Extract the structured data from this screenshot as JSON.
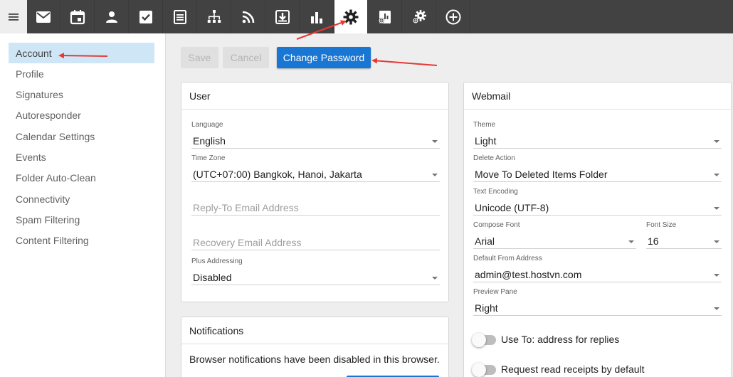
{
  "nav": {
    "icons": [
      "mail-icon",
      "calendar-icon",
      "contacts-icon",
      "tasks-icon",
      "notes-icon",
      "sitemap-icon",
      "rss-icon",
      "download-icon",
      "bar-chart-icon",
      "settings-icon",
      "domain-report-icon",
      "domain-settings-icon",
      "add-icon"
    ],
    "active": "settings-icon"
  },
  "sidebar": {
    "items": [
      {
        "label": "Account"
      },
      {
        "label": "Profile"
      },
      {
        "label": "Signatures"
      },
      {
        "label": "Autoresponder"
      },
      {
        "label": "Calendar Settings"
      },
      {
        "label": "Events"
      },
      {
        "label": "Folder Auto-Clean"
      },
      {
        "label": "Connectivity"
      },
      {
        "label": "Spam Filtering"
      },
      {
        "label": "Content Filtering"
      }
    ],
    "active": "Account"
  },
  "toolbar": {
    "save_label": "Save",
    "cancel_label": "Cancel",
    "change_password_label": "Change Password"
  },
  "user_card": {
    "title": "User",
    "language_label": "Language",
    "language_value": "English",
    "timezone_label": "Time Zone",
    "timezone_value": "(UTC+07:00) Bangkok, Hanoi, Jakarta",
    "reply_to_placeholder": "Reply-To Email Address",
    "recovery_placeholder": "Recovery Email Address",
    "plus_label": "Plus Addressing",
    "plus_value": "Disabled"
  },
  "notifications_card": {
    "title": "Notifications",
    "message": "Browser notifications have been disabled in this browser."
  },
  "webmail_card": {
    "title": "Webmail",
    "theme_label": "Theme",
    "theme_value": "Light",
    "delete_label": "Delete Action",
    "delete_value": "Move To Deleted Items Folder",
    "encoding_label": "Text Encoding",
    "encoding_value": "Unicode (UTF-8)",
    "font_label": "Compose Font",
    "font_value": "Arial",
    "font_size_label": "Font Size",
    "font_size_value": "16",
    "from_label": "Default From Address",
    "from_value": "admin@test.hostvn.com",
    "preview_label": "Preview Pane",
    "preview_value": "Right",
    "toggle_reply_label": "Use To: address for replies",
    "toggle_reply_on": false,
    "toggle_receipts_label": "Request read receipts by default",
    "toggle_receipts_on": false
  },
  "colors": {
    "topbar": "#424242",
    "accent": "#1976d2",
    "sidebar_active": "#cfe6f6",
    "annotation": "#e53935"
  }
}
